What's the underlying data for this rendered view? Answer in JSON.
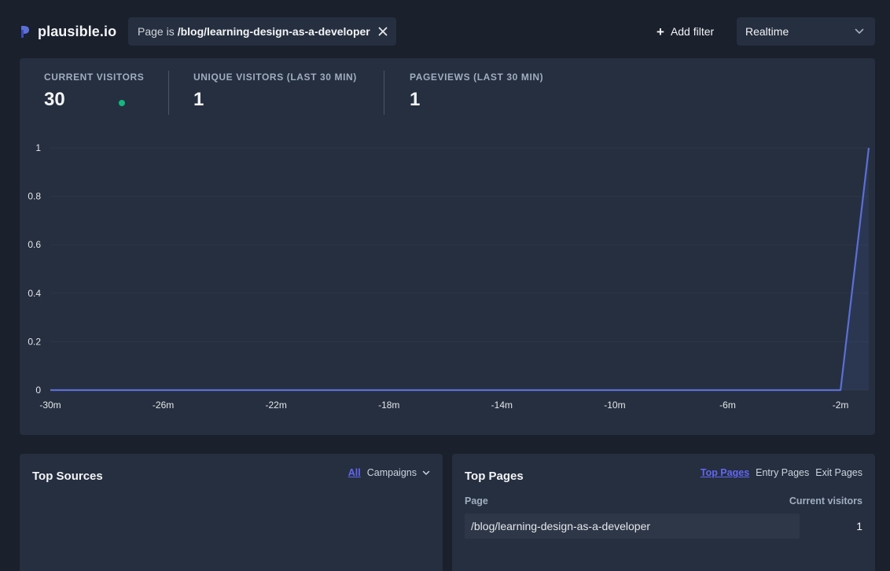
{
  "header": {
    "site_name": "plausible.io",
    "filter": {
      "prefix": "Page is",
      "value": "/blog/learning-design-as-a-developer"
    },
    "add_filter_label": "Add filter",
    "period_label": "Realtime"
  },
  "stats": [
    {
      "label": "CURRENT VISITORS",
      "value": "30"
    },
    {
      "label": "UNIQUE VISITORS (LAST 30 MIN)",
      "value": "1"
    },
    {
      "label": "PAGEVIEWS (LAST 30 MIN)",
      "value": "1"
    }
  ],
  "colors": {
    "accent": "#5b6fd6",
    "live": "#10b981",
    "panel": "#252f3f",
    "background": "#1a202c"
  },
  "chart_data": {
    "type": "area",
    "x": [
      "-30m",
      "-29m",
      "-28m",
      "-27m",
      "-26m",
      "-25m",
      "-24m",
      "-23m",
      "-22m",
      "-21m",
      "-20m",
      "-19m",
      "-18m",
      "-17m",
      "-16m",
      "-15m",
      "-14m",
      "-13m",
      "-12m",
      "-11m",
      "-10m",
      "-9m",
      "-8m",
      "-7m",
      "-6m",
      "-5m",
      "-4m",
      "-3m",
      "-2m",
      "-1m"
    ],
    "x_ticks": [
      "-30m",
      "-26m",
      "-22m",
      "-18m",
      "-14m",
      "-10m",
      "-6m",
      "-2m"
    ],
    "values": [
      0,
      0,
      0,
      0,
      0,
      0,
      0,
      0,
      0,
      0,
      0,
      0,
      0,
      0,
      0,
      0,
      0,
      0,
      0,
      0,
      0,
      0,
      0,
      0,
      0,
      0,
      0,
      0,
      0,
      1
    ],
    "y_ticks": [
      "0",
      "0.2",
      "0.4",
      "0.6",
      "0.8",
      "1"
    ],
    "ylim": [
      0,
      1
    ],
    "grid": true,
    "xlabel": "",
    "ylabel": ""
  },
  "sources": {
    "title": "Top Sources",
    "tabs": {
      "all": "All",
      "campaigns": "Campaigns"
    }
  },
  "pages": {
    "title": "Top Pages",
    "tabs": {
      "top": "Top Pages",
      "entry": "Entry Pages",
      "exit": "Exit Pages"
    },
    "col_page": "Page",
    "col_visitors": "Current visitors",
    "rows": [
      {
        "page": "/blog/learning-design-as-a-developer",
        "visitors": "1"
      }
    ]
  }
}
